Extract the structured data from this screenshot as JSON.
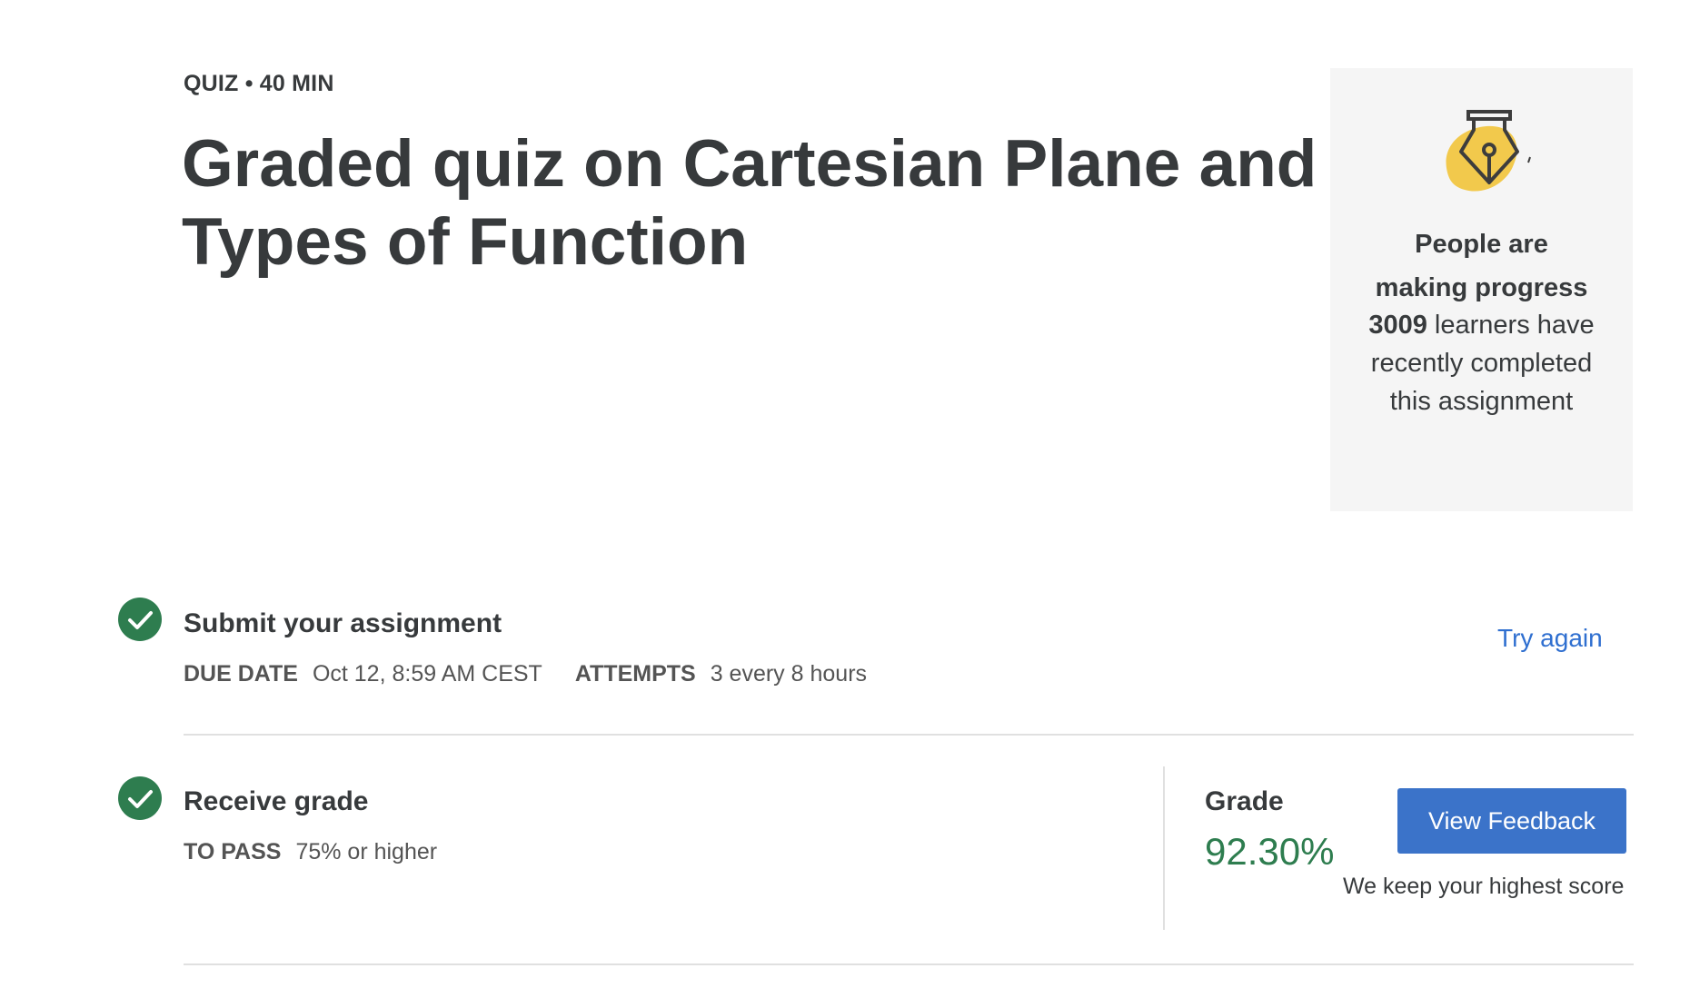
{
  "header": {
    "item_type": "QUIZ",
    "separator": "•",
    "duration": "40 MIN",
    "title": "Graded quiz on Cartesian Plane and Types of Function"
  },
  "progress_card": {
    "icon": "pen-nib-icon",
    "heading_line1": "People are",
    "heading_line2": "making progress",
    "learner_count": "3009",
    "body_text": "learners have recently completed this assignment",
    "accent_color": "#f2c94c"
  },
  "submit_step": {
    "title": "Submit your assignment",
    "due_date_label": "DUE DATE",
    "due_date_value": "Oct 12, 8:59 AM CEST",
    "attempts_label": "ATTEMPTS",
    "attempts_value": "3 every 8 hours",
    "try_again_label": "Try again",
    "status": "complete"
  },
  "grade_step": {
    "title": "Receive grade",
    "to_pass_label": "TO PASS",
    "to_pass_value": "75% or higher",
    "grade_label": "Grade",
    "grade_value": "92.30%",
    "view_feedback_label": "View Feedback",
    "highest_score_note": "We keep your highest score",
    "status": "complete"
  },
  "colors": {
    "success_green": "#2e7d4f",
    "link_blue": "#2f6fd0",
    "button_blue": "#3b73c9",
    "text_dark": "#373a3c",
    "card_bg": "#f5f5f5"
  }
}
